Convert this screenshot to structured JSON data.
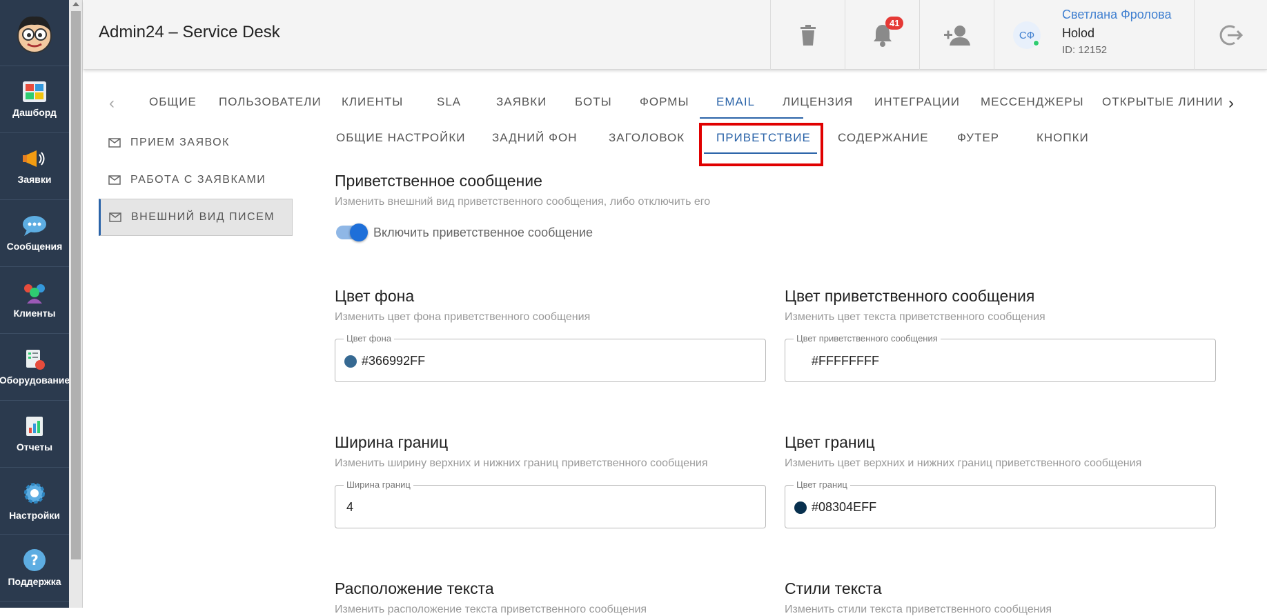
{
  "rail": {
    "items": [
      {
        "label": "Дашборд",
        "icon": "dashboard-icon"
      },
      {
        "label": "Заявки",
        "icon": "megaphone-icon"
      },
      {
        "label": "Сообщения",
        "icon": "chat-bubble-icon"
      },
      {
        "label": "Клиенты",
        "icon": "clients-icon"
      },
      {
        "label": "Оборудование",
        "icon": "equipment-icon"
      },
      {
        "label": "Отчеты",
        "icon": "reports-icon"
      },
      {
        "label": "Настройки",
        "icon": "gear-icon"
      },
      {
        "label": "Поддержка",
        "icon": "help-icon"
      }
    ]
  },
  "header": {
    "title": "Admin24 – Service Desk",
    "notifications_count": "41",
    "user": {
      "initials": "СФ",
      "name": "Светлана Фролова",
      "org": "Holod",
      "id": "ID: 12152"
    }
  },
  "top_tabs": [
    "ОБЩИЕ",
    "ПОЛЬЗОВАТЕЛИ",
    "КЛИЕНТЫ",
    "SLA",
    "ЗАЯВКИ",
    "БОТЫ",
    "ФОРМЫ",
    "EMAIL",
    "ЛИЦЕНЗИЯ",
    "ИНТЕГРАЦИИ",
    "МЕССЕНДЖЕРЫ",
    "ОТКРЫТЫЕ ЛИНИИ"
  ],
  "top_tabs_active": "EMAIL",
  "side_menu": [
    "ПРИЕМ ЗАЯВОК",
    "РАБОТА С ЗАЯВКАМИ",
    "ВНЕШНИЙ ВИД ПИСЕМ"
  ],
  "side_menu_active": "ВНЕШНИЙ ВИД ПИСЕМ",
  "sub_tabs": [
    "ОБЩИЕ НАСТРОЙКИ",
    "ЗАДНИЙ ФОН",
    "ЗАГОЛОВОК",
    "ПРИВЕТСТВИЕ",
    "СОДЕРЖАНИЕ",
    "ФУТЕР",
    "КНОПКИ"
  ],
  "sub_tabs_active": "ПРИВЕТСТВИЕ",
  "greeting": {
    "title": "Приветственное сообщение",
    "desc": "Изменить внешний вид приветственного сообщения, либо отключить его",
    "toggle_label": "Включить приветственное сообщение",
    "toggle_on": true
  },
  "bg_color": {
    "title": "Цвет фона",
    "desc": "Изменить цвет фона приветственного сообщения",
    "field_label": "Цвет фона",
    "value": "#366992FF",
    "swatch": "#366992"
  },
  "text_color": {
    "title": "Цвет приветственного сообщения",
    "desc": "Изменить цвет текста приветственного сообщения",
    "field_label": "Цвет приветственного сообщения",
    "value": "#FFFFFFFF",
    "swatch": "#FFFFFF"
  },
  "border_width": {
    "title": "Ширина границ",
    "desc": "Изменить ширину верхних и нижних границ приветственного сообщения",
    "field_label": "Ширина границ",
    "value": "4"
  },
  "border_color": {
    "title": "Цвет границ",
    "desc": "Изменить цвет верхних и нижних границ приветственного сообщения",
    "field_label": "Цвет границ",
    "value": "#08304EFF",
    "swatch": "#08304E"
  },
  "text_position": {
    "title": "Расположение текста",
    "desc": "Изменить расположение текста приветственного сообщения"
  },
  "text_styles": {
    "title": "Стили текста",
    "desc": "Изменить стили текста приветственного сообщения"
  },
  "colors": {
    "accent": "#2a63a8",
    "rail_bg": "#2b3a4e",
    "highlight": "#e00000",
    "badge": "#e53935"
  }
}
